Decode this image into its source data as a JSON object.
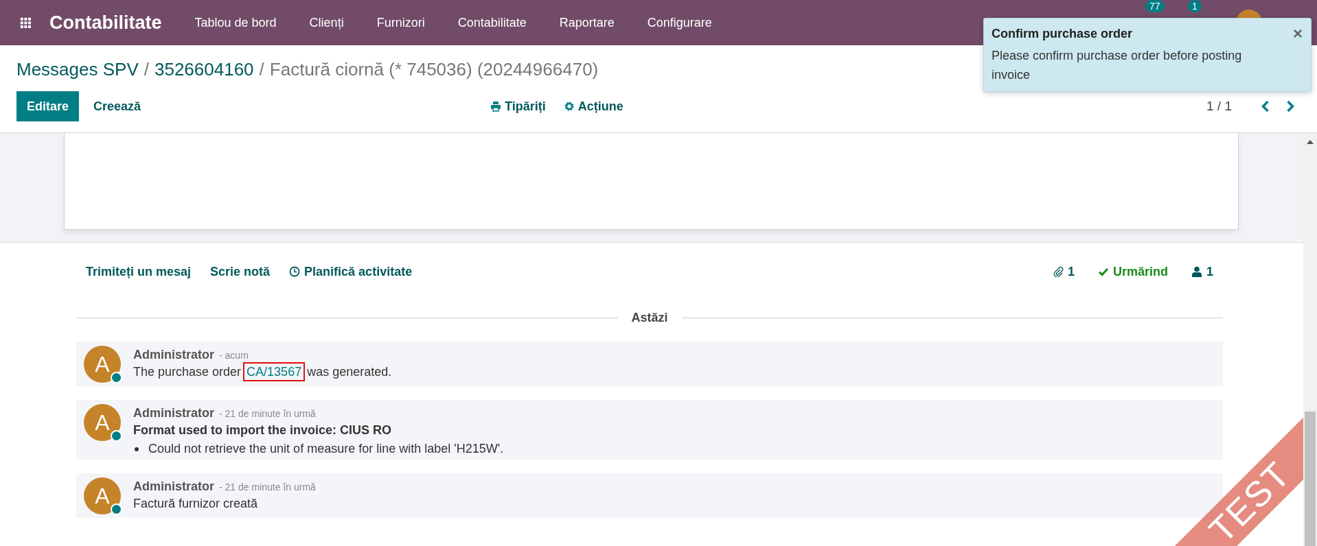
{
  "navbar": {
    "brand": "Contabilitate",
    "menu": [
      "Tablou de bord",
      "Clienți",
      "Furnizori",
      "Contabilitate",
      "Raportare",
      "Configurare"
    ],
    "systray": [
      {
        "badge": "77"
      },
      {
        "badge": "1"
      }
    ]
  },
  "breadcrumb": {
    "separator": "/",
    "items": [
      {
        "label": "Messages SPV",
        "link": true
      },
      {
        "label": "3526604160",
        "link": true
      },
      {
        "label": "Factură ciornă (* 745036) (20244966470)",
        "link": false
      }
    ]
  },
  "buttons": [
    {
      "label": "Editare",
      "kind": "primary"
    },
    {
      "label": "Creează",
      "kind": "secondary"
    }
  ],
  "actions": [
    {
      "label": "Tipăriți",
      "kind": "print"
    },
    {
      "label": "Acțiune",
      "kind": "gear"
    }
  ],
  "pager": {
    "value": "1 / 1"
  },
  "chatter": {
    "buttons": [
      {
        "label": "Trimiteți un mesaj",
        "kind": "plain"
      },
      {
        "label": "Scrie notă",
        "kind": "plain"
      },
      {
        "label": "Planifică activitate",
        "kind": "clock"
      }
    ],
    "attachments": "1",
    "following": {
      "label": "Urmărind",
      "on": true
    },
    "followers": "1",
    "date_separator": "Astăzi",
    "messages": [
      {
        "kind": "link_sentence",
        "author": "Administrator",
        "time": "- acum",
        "avatar": "A",
        "online": true,
        "before": "The purchase order",
        "link": "CA/13567",
        "after": "was generated.",
        "highlighted": true
      },
      {
        "kind": "bullets",
        "author": "Administrator",
        "time": "- 21 de minute în urmă",
        "avatar": "A",
        "online": true,
        "title": "Format used to import the invoice: CIUS RO",
        "bullets": [
          "Could not retrieve the unit of measure for line with label 'H215W'."
        ]
      },
      {
        "kind": "text",
        "author": "Administrator",
        "time": "- 21 de minute în urmă",
        "avatar": "A",
        "online": true,
        "text": "Factură furnizor creată"
      }
    ]
  },
  "toast": {
    "title": "Confirm purchase order",
    "message": "Please confirm purchase order before posting invoice",
    "close": "×"
  },
  "ribbon": {
    "label": "TEST"
  }
}
